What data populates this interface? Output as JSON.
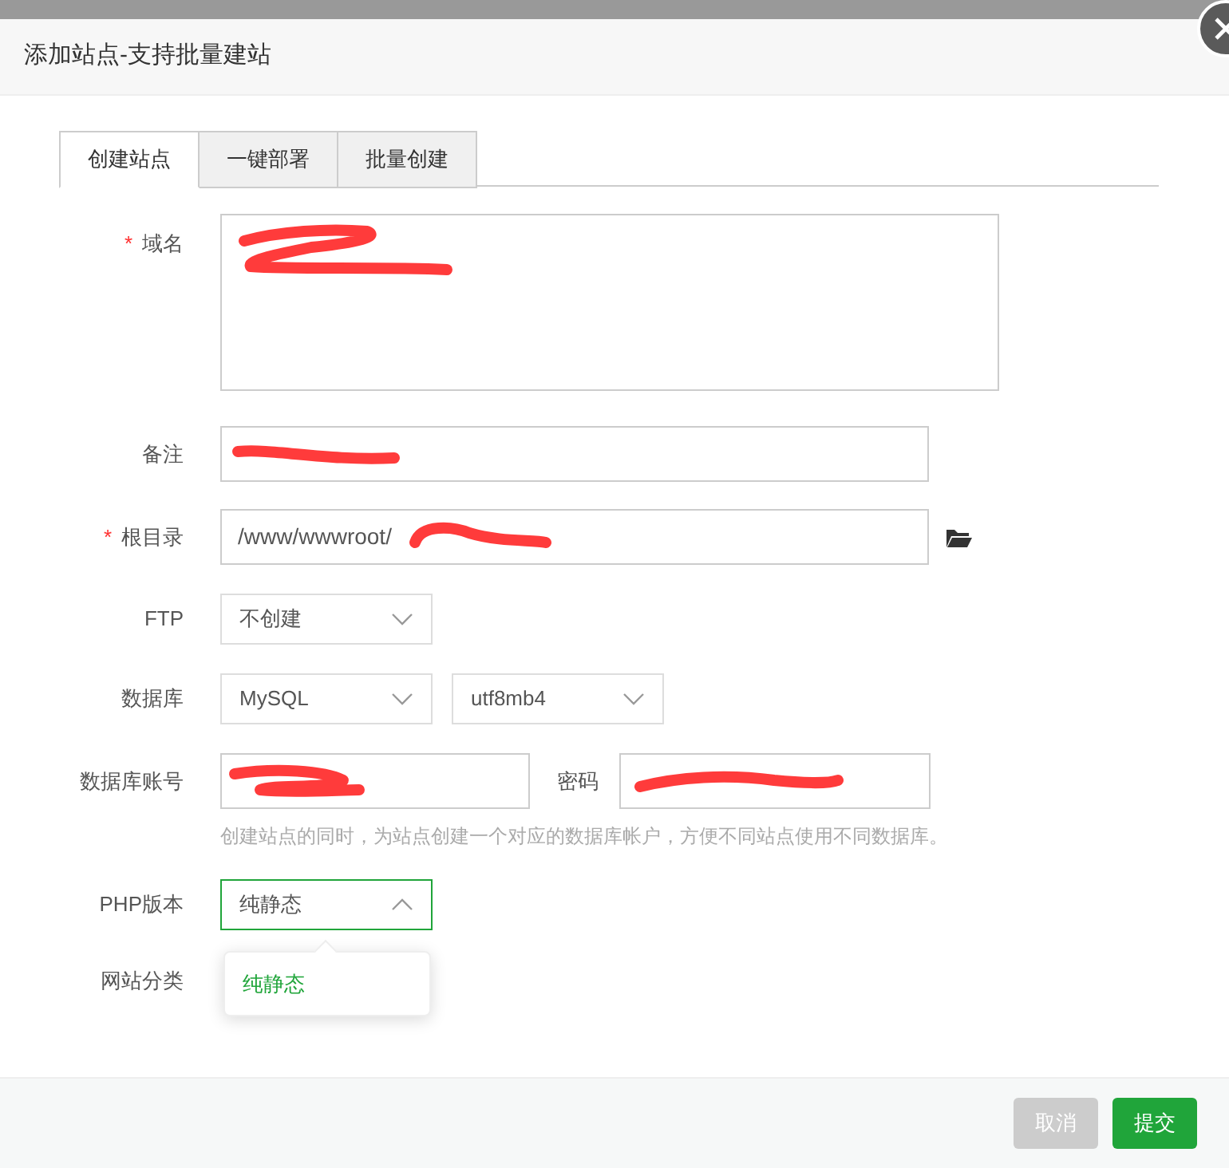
{
  "dialog": {
    "title": "添加站点-支持批量建站"
  },
  "tabs": [
    {
      "label": "创建站点",
      "selected": true
    },
    {
      "label": "一键部署",
      "selected": false
    },
    {
      "label": "批量创建",
      "selected": false
    }
  ],
  "form": [
    {
      "kind": "textarea",
      "label": "域名",
      "required_mark": "*",
      "redacted": true
    },
    {
      "kind": "input",
      "label": "备注",
      "redacted": true
    },
    {
      "kind": "path",
      "label": "根目录",
      "required_mark": "*",
      "value": "/www/wwwroot/",
      "redacted": true
    },
    {
      "kind": "select",
      "label": "FTP",
      "value": "不创建",
      "expanded": false
    },
    {
      "kind": "select_pair",
      "label": "数据库",
      "selects": [
        {
          "value": "MySQL"
        },
        {
          "value": "utf8mb4"
        }
      ]
    },
    {
      "kind": "account",
      "label": "数据库账号",
      "redacted": true,
      "password_label": "密码",
      "password_redacted": true,
      "hint": "创建站点的同时，为站点创建一个对应的数据库帐户，方便不同站点使用不同数据库。"
    },
    {
      "kind": "select",
      "label": "PHP版本",
      "value": "纯静态",
      "expanded": true,
      "options": [
        {
          "label": "纯静态",
          "selected": true
        }
      ]
    },
    {
      "kind": "label_only",
      "label": "网站分类"
    }
  ],
  "buttons": [
    {
      "label": "取消",
      "kind": "cancel"
    },
    {
      "label": "提交",
      "kind": "submit"
    }
  ]
}
